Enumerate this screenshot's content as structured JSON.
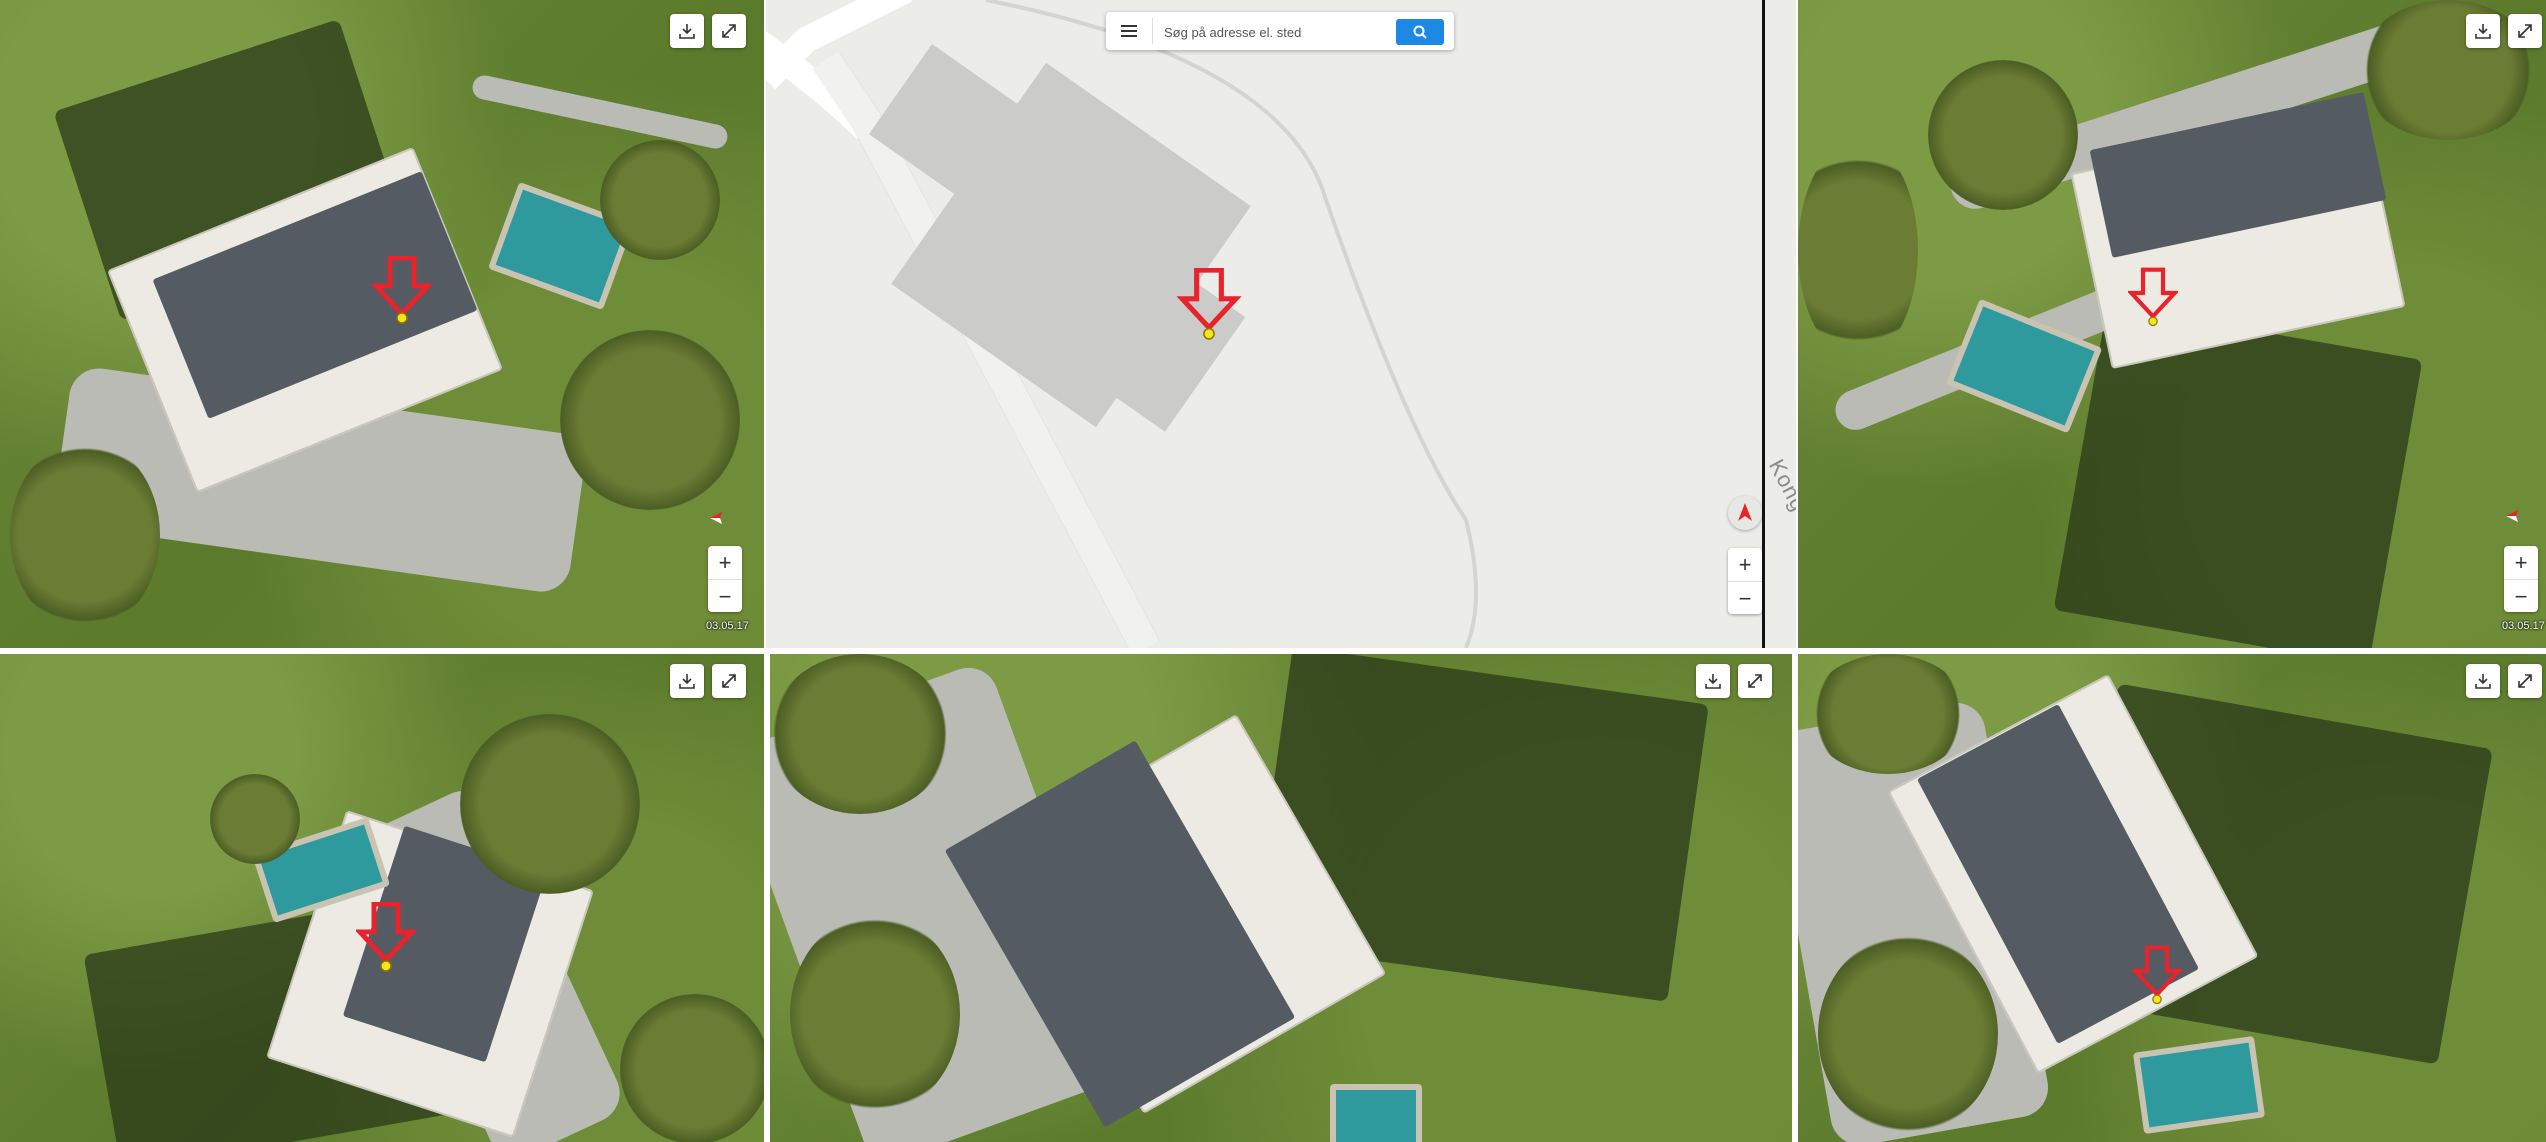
{
  "search": {
    "placeholder": "Søg på adresse el. sted"
  },
  "map": {
    "street_name": "Kongevejen"
  },
  "panes": {
    "top_left": {
      "date": "03.05.17"
    },
    "top_right": {
      "date": "03.05.17"
    }
  },
  "controls": {
    "zoom_in": "+",
    "zoom_out": "−"
  },
  "colors": {
    "marker": "#e8232b",
    "marker_dot": "#f5e61c",
    "search_button": "#1e88e5"
  }
}
